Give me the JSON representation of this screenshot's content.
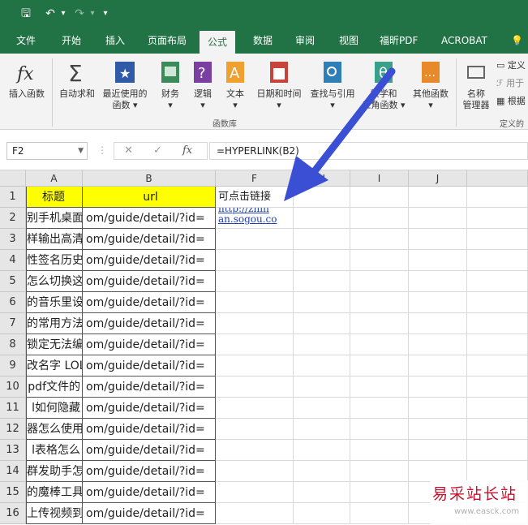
{
  "qat": {
    "save": "🖫",
    "undo": "↶",
    "redo": "↷",
    "customize": "▾"
  },
  "tabs": [
    "文件",
    "开始",
    "插入",
    "页面布局",
    "公式",
    "数据",
    "审阅",
    "视图",
    "福昕PDF",
    "ACROBAT"
  ],
  "active_tab": "公式",
  "tell_icon": "💡",
  "ribbon": {
    "insert_function": "插入函数",
    "autosum": "自动求和",
    "recent_line1": "最近使用的",
    "recent_line2": "函数",
    "financial": "财务",
    "logical": "逻辑",
    "text": "文本",
    "datetime": "日期和时间",
    "lookup": "查找与引用",
    "math_line1": "数学和",
    "math_line2": "三角函数",
    "more": "其他函数",
    "name_mgr_line1": "名称",
    "name_mgr_line2": "管理器",
    "define_name": "定义",
    "use_in_formula": "用于",
    "create_from_selection": "根据",
    "group_library": "函数库",
    "group_defined": "定义的"
  },
  "formula_bar": {
    "name_box": "F2",
    "formula": "=HYPERLINK(B2)"
  },
  "columns": [
    "A",
    "B",
    "F",
    "H",
    "I",
    "J"
  ],
  "rows": [
    {
      "n": "1",
      "a": "标题",
      "b": "url",
      "f": "可点击链接"
    },
    {
      "n": "2",
      "a": "别手机桌面",
      "b": "om/guide/detail/?id=",
      "f": "http://zhin",
      "f2": "an.sogou.co"
    },
    {
      "n": "3",
      "a": "样输出高清",
      "b": "om/guide/detail/?id=",
      "f": ""
    },
    {
      "n": "4",
      "a": "性签名历史",
      "b": "om/guide/detail/?id=",
      "f": ""
    },
    {
      "n": "5",
      "a": "怎么切换这",
      "b": "om/guide/detail/?id=",
      "f": ""
    },
    {
      "n": "6",
      "a": "的音乐里设",
      "b": "om/guide/detail/?id=",
      "f": ""
    },
    {
      "n": "7",
      "a": "的常用方法",
      "b": "om/guide/detail/?id=",
      "f": ""
    },
    {
      "n": "8",
      "a": "锁定无法编",
      "b": "om/guide/detail/?id=",
      "f": ""
    },
    {
      "n": "9",
      "a": "改名字 LOL",
      "b": "om/guide/detail/?id=",
      "f": ""
    },
    {
      "n": "10",
      "a": "pdf文件的",
      "b": "om/guide/detail/?id=",
      "f": ""
    },
    {
      "n": "11",
      "a": "l如何隐藏",
      "b": "om/guide/detail/?id=",
      "f": ""
    },
    {
      "n": "12",
      "a": "器怎么使用",
      "b": "om/guide/detail/?id=",
      "f": ""
    },
    {
      "n": "13",
      "a": "l表格怎么",
      "b": "om/guide/detail/?id=",
      "f": ""
    },
    {
      "n": "14",
      "a": "群发助手怎",
      "b": "om/guide/detail/?id=",
      "f": ""
    },
    {
      "n": "15",
      "a": "的魔棒工具",
      "b": "om/guide/detail/?id=",
      "f": ""
    },
    {
      "n": "16",
      "a": "上传视频到",
      "b": "om/guide/detail/?id=",
      "f": ""
    }
  ],
  "watermark": {
    "line1": "易采站长站",
    "line2": "www.easck.com"
  },
  "colors": {
    "excel_green": "#217346",
    "header_yellow": "#ffff00",
    "arrow_blue": "#3a4fd4",
    "link_blue": "#1f3fb3"
  }
}
